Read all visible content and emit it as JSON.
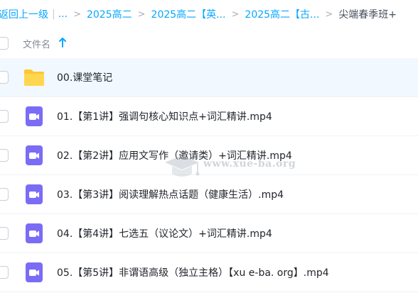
{
  "breadcrumb": {
    "back_label": "返回上一级",
    "ellipsis": "...",
    "items": [
      "2025高二",
      "2025高二【英...",
      "2025高二【古...",
      "尖端春季班+"
    ]
  },
  "list_header": {
    "name_label": "文件名",
    "sort_icon": "arrow-up-icon"
  },
  "files": [
    {
      "name": "00.课堂笔记",
      "icon": "folder-icon",
      "selected": false
    },
    {
      "name": "01.【第1讲】强调句核心知识点+词汇精讲.mp4",
      "icon": "video-icon",
      "selected": false
    },
    {
      "name": "02.【第2讲】应用文写作（邀请类）+词汇精讲.mp4",
      "icon": "video-icon",
      "selected": false
    },
    {
      "name": "03.【第3讲】阅读理解热点话题（健康生活）.mp4",
      "icon": "video-icon",
      "selected": false
    },
    {
      "name": "04.【第4讲】七选五（议论文）+词汇精讲.mp4",
      "icon": "video-icon",
      "selected": false
    },
    {
      "name": "05.【第5讲】非谓语高级（独立主格）【xu e-ba. org】.mp4",
      "icon": "video-icon",
      "selected": false
    }
  ],
  "watermark": {
    "text": "www.xue-ba.org"
  },
  "colors": {
    "link": "#06a7ff",
    "folder": "#ffd64f",
    "video": "#7b6cf6",
    "row_highlight": "#f1f8ff"
  }
}
